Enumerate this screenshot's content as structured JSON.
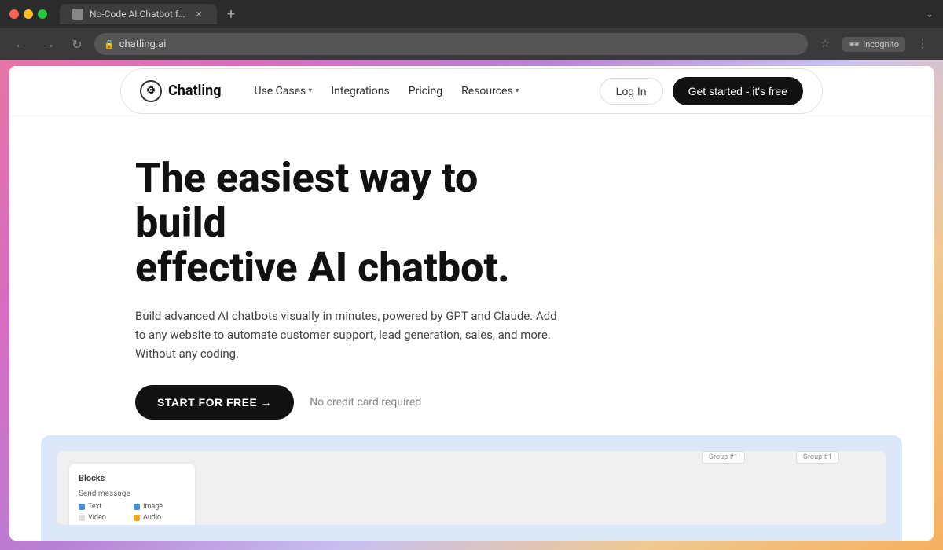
{
  "browser": {
    "tab_title": "No-Code AI Chatbot for You...",
    "url": "chatling.ai",
    "incognito_label": "Incognito"
  },
  "nav": {
    "logo_text": "Chatling",
    "logo_icon": "⚙",
    "use_cases_label": "Use Cases",
    "integrations_label": "Integrations",
    "pricing_label": "Pricing",
    "resources_label": "Resources",
    "login_label": "Log In",
    "cta_label": "Get started - it's free"
  },
  "hero": {
    "headline_line1": "The easiest way to build",
    "headline_line2": "effective AI chatbot.",
    "subtext": "Build advanced AI chatbots visually in minutes, powered by GPT and Claude. Add to any website to automate customer support, lead generation, sales, and more. Without any coding.",
    "cta_button": "START FOR FREE →",
    "no_cc_text": "No credit card required"
  },
  "preview": {
    "panel_title": "Blocks",
    "panel_section": "Send message",
    "items": [
      {
        "label": "Text",
        "color": "blue"
      },
      {
        "label": "Image",
        "color": "blue"
      },
      {
        "label": "Video",
        "color": "default"
      },
      {
        "label": "Audio",
        "color": "orange"
      }
    ],
    "group_label1": "Group #1",
    "group_label2": "Group #1"
  }
}
